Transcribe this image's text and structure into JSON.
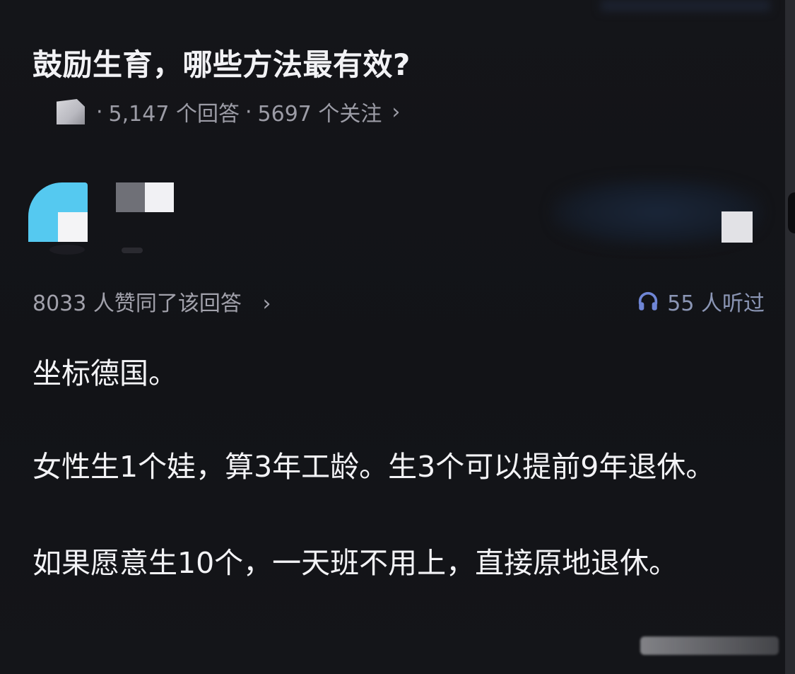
{
  "question": {
    "title": "鼓励生育，哪些方法最有效?",
    "answer_count": "5,147 个回答",
    "follower_count": "5697 个关注",
    "separator": "·",
    "chevron": "›"
  },
  "answer_meta": {
    "upvote_text": "8033 人赞同了该回答",
    "chevron": "›",
    "listen_count": "55 人听过",
    "listen_icon": "headphone-icon"
  },
  "answer": {
    "paragraphs": [
      "坐标德国。",
      "女性生1个娃，算3年工龄。生3个可以提前9年退休。",
      "如果愿意生10个，一天班不用上，直接原地退休。"
    ]
  },
  "colors": {
    "background": "#141418",
    "text_primary": "#f3f3f6",
    "text_secondary": "#a1a1ab",
    "listen_accent": "#8b96b5",
    "avatar_cyan": "#55c9f0"
  }
}
